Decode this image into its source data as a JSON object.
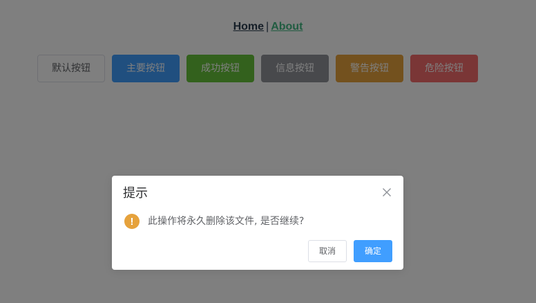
{
  "nav": {
    "home_label": "Home",
    "separator": "|",
    "about_label": "About"
  },
  "buttons": {
    "default_label": "默认按钮",
    "primary_label": "主要按钮",
    "success_label": "成功按钮",
    "info_label": "信息按钮",
    "warning_label": "警告按钮",
    "danger_label": "危险按钮"
  },
  "dialog": {
    "title": "提示",
    "status_icon_glyph": "!",
    "message": "此操作将永久删除该文件, 是否继续?",
    "cancel_label": "取消",
    "confirm_label": "确定"
  },
  "icons": {
    "close": "close-icon",
    "status": "warning-icon"
  },
  "colors": {
    "nav_text": "#2c3e50",
    "nav_link_active": "#42b983",
    "primary": "#409eff",
    "success": "#67c23a",
    "info": "#909399",
    "warning": "#e6a23c",
    "danger": "#f56c6c",
    "overlay": "rgba(0,0,0,0.5)"
  }
}
